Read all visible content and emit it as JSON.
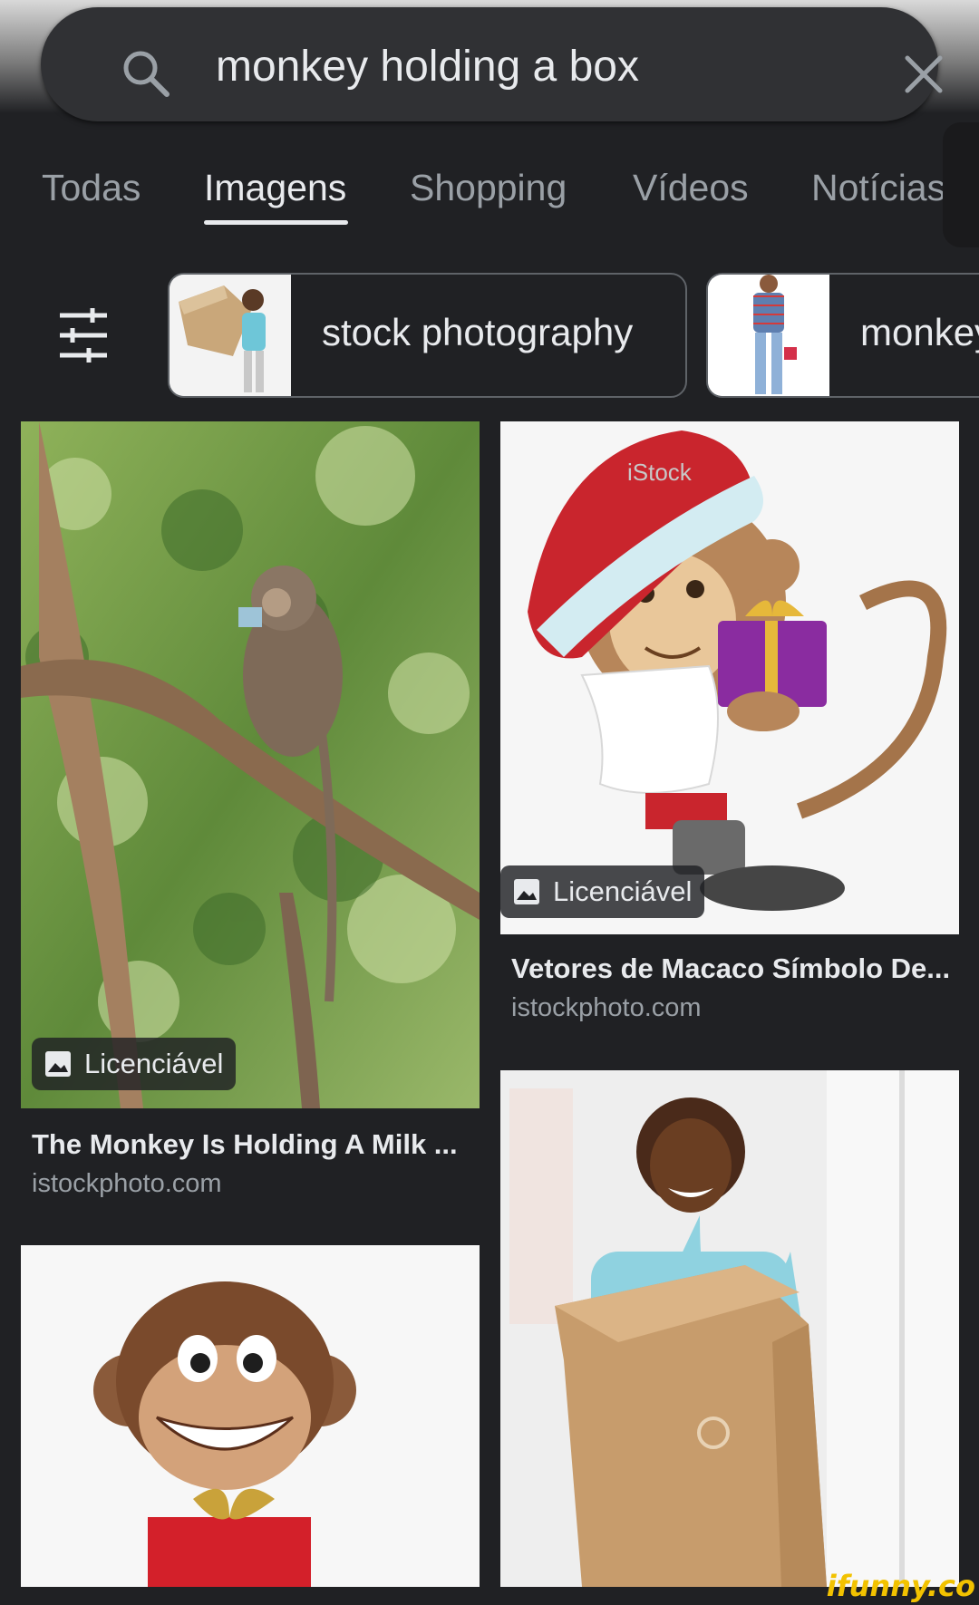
{
  "search": {
    "query": "monkey holding a box",
    "search_icon": "search-icon",
    "clear_icon": "close-icon"
  },
  "tabs": [
    {
      "label": "Todas",
      "active": false
    },
    {
      "label": "Imagens",
      "active": true
    },
    {
      "label": "Shopping",
      "active": false
    },
    {
      "label": "Vídeos",
      "active": false
    },
    {
      "label": "Notícias",
      "active": false
    }
  ],
  "filters": {
    "icon": "sliders-icon",
    "chips": [
      {
        "label": "stock photography"
      },
      {
        "label": "monkey"
      }
    ]
  },
  "results": [
    {
      "title": "The Monkey Is Holding A Milk ...",
      "source": "istockphoto.com",
      "badge": "Licenciável"
    },
    {
      "title": "Vetores de Macaco Símbolo De...",
      "source": "istockphoto.com",
      "badge": "Licenciável"
    },
    {
      "title": "",
      "source": "",
      "badge": ""
    },
    {
      "title": "",
      "source": "",
      "badge": ""
    }
  ],
  "colors": {
    "background": "#202124",
    "search_bg": "#303134",
    "text_primary": "#e8eaed",
    "text_secondary": "#9aa0a6",
    "watermark": "#f2c200"
  },
  "watermark": "ifunny.co"
}
